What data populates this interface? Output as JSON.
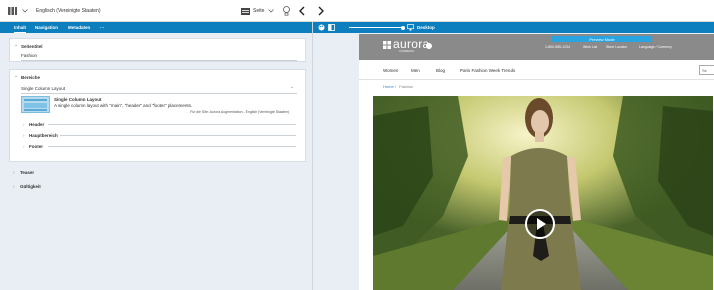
{
  "topbar": {
    "language": "Englisch (Vereinigte Staaten)",
    "view_label": "Seite"
  },
  "editor": {
    "tabs": [
      {
        "label": "Inhalt"
      },
      {
        "label": "Navigation"
      },
      {
        "label": "Metadaten"
      },
      {
        "label": "···"
      }
    ],
    "sections": {
      "seitentitel": {
        "label": "Seitentitel",
        "value": "Fashion"
      },
      "bereiche": {
        "label": "Bereiche",
        "layout_select": "Single Column Layout",
        "layout_name": "Single Column Layout",
        "layout_desc": "A single column layout with \"main\", \"header\" and \"footer\" placements.",
        "layout_note": "Für die Site: Aurora Augmentation - English (Vereinigte Staaten)",
        "placements": [
          {
            "label": "Header"
          },
          {
            "label": "Hauptbereich"
          },
          {
            "label": "Footer"
          }
        ]
      },
      "teaser": {
        "label": "Teaser"
      },
      "gueltigkeit": {
        "label": "Gültigkeit"
      }
    }
  },
  "preview": {
    "device": "Desktop",
    "banner": "Preview Mode",
    "logo": "aurora",
    "logo_sub": "COMMERCE",
    "phone": "1-800-555-1234",
    "links": [
      "Wish List",
      "Store Locator",
      "Language / Currency"
    ],
    "nav": [
      "Women",
      "Men",
      "Blog",
      "Paris Fashion Week Trends"
    ],
    "search_text": "Se",
    "breadcrumb": {
      "home": "Home",
      "separator": "/",
      "current": "Fashion"
    }
  },
  "colors": {
    "accent": "#0d7fbf",
    "header_gray": "#8a8a8a",
    "pane_bg": "#e8eef3"
  }
}
